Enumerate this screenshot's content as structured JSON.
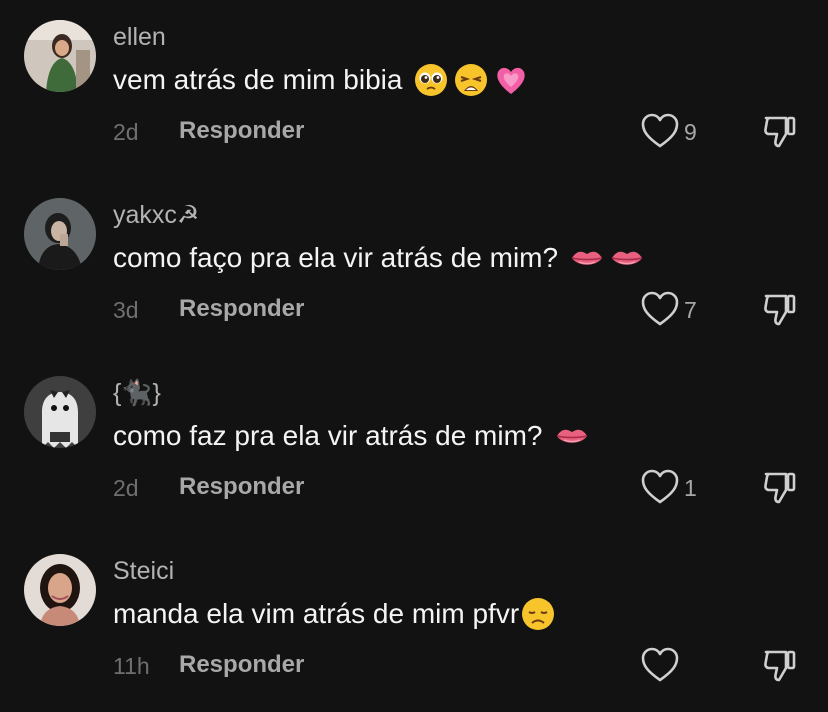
{
  "comments": [
    {
      "username": "ellen",
      "text": "vem atrás de mim bibia",
      "emojis": [
        "pleading-face",
        "weary-face",
        "growing-heart"
      ],
      "time": "2d",
      "reply_label": "Responder",
      "likes": "9",
      "avatar": "woman-green-dress"
    },
    {
      "username": "yakxc☭",
      "text": "como faço pra ela vir atrás de mim?",
      "emojis": [
        "lips",
        "lips"
      ],
      "time": "3d",
      "reply_label": "Responder",
      "likes": "7",
      "avatar": "person-dark"
    },
    {
      "username": "{🐈‍⬛}",
      "text": "como faz pra ela vir atrás de mim?",
      "emojis": [
        "lips"
      ],
      "time": "2d",
      "reply_label": "Responder",
      "likes": "1",
      "avatar": "ghost-cat"
    },
    {
      "username": "Steici",
      "text": "manda ela vim atrás de mim pfvr",
      "emojis": [
        "disappointed-face"
      ],
      "time": "11h",
      "reply_label": "Responder",
      "likes": "",
      "avatar": "woman-selfie"
    }
  ],
  "colors": {
    "background": "#121212",
    "username": "#b3b3b3",
    "text": "#f4f4f4",
    "time": "#6f6f6f",
    "action": "#a8a8a8"
  }
}
